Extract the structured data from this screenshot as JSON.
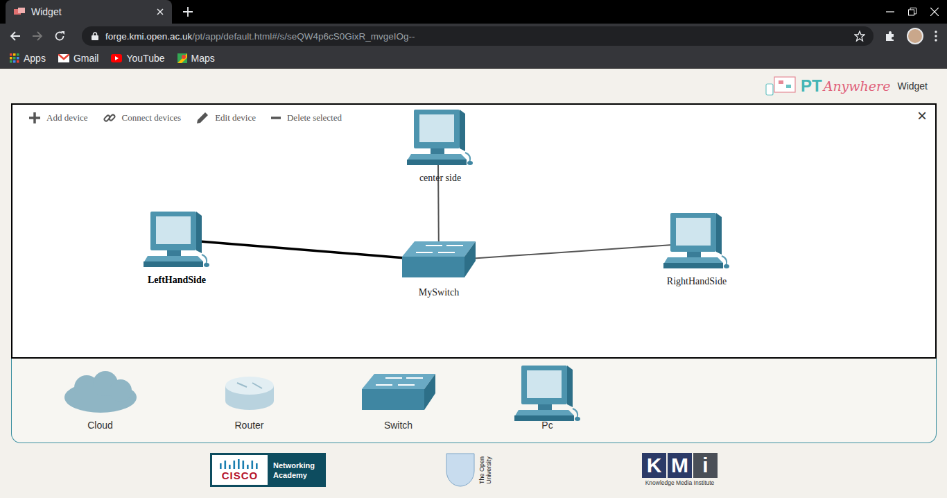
{
  "browser": {
    "tab": {
      "title": "Widget"
    },
    "address": {
      "host": "forge.kmi.open.ac.uk",
      "path": "/pt/app/default.html#/s/seQW4p6cS0GixR_mvgeIOg--"
    },
    "bookmarks": [
      {
        "label": "Apps",
        "kind": "apps"
      },
      {
        "label": "Gmail",
        "kind": "gmail"
      },
      {
        "label": "YouTube",
        "kind": "youtube"
      },
      {
        "label": "Maps",
        "kind": "maps"
      }
    ]
  },
  "header": {
    "brand_pt": "PT",
    "brand_anywhere": "Anywhere",
    "label": "Widget"
  },
  "toolbar": {
    "actions": [
      {
        "label": "Add device",
        "kind": "add"
      },
      {
        "label": "Connect devices",
        "kind": "connect"
      },
      {
        "label": "Edit device",
        "kind": "edit"
      },
      {
        "label": "Delete selected",
        "kind": "delete"
      }
    ],
    "close": "×"
  },
  "network": {
    "nodes": [
      {
        "name": "center side",
        "kind": "pc",
        "selected": false
      },
      {
        "name": "LeftHandSide",
        "kind": "pc",
        "selected": true
      },
      {
        "name": "MySwitch",
        "kind": "switch",
        "selected": false
      },
      {
        "name": "RightHandSide",
        "kind": "pc",
        "selected": false
      }
    ],
    "links": [
      {
        "from": "LeftHandSide",
        "to": "MySwitch",
        "selected": true
      },
      {
        "from": "center side",
        "to": "MySwitch",
        "selected": false
      },
      {
        "from": "MySwitch",
        "to": "RightHandSide",
        "selected": false
      }
    ]
  },
  "palette": [
    {
      "label": "Cloud",
      "kind": "cloud"
    },
    {
      "label": "Router",
      "kind": "router"
    },
    {
      "label": "Switch",
      "kind": "switch"
    },
    {
      "label": "Pc",
      "kind": "pc"
    }
  ],
  "footer": {
    "cisco": {
      "word": "CISCO",
      "program": [
        "Networking",
        "Academy"
      ]
    },
    "open_university": [
      "The Open",
      "University"
    ],
    "kmi": {
      "letters": [
        "K",
        "M",
        "i"
      ],
      "name": "Knowledge Media Institute"
    }
  }
}
